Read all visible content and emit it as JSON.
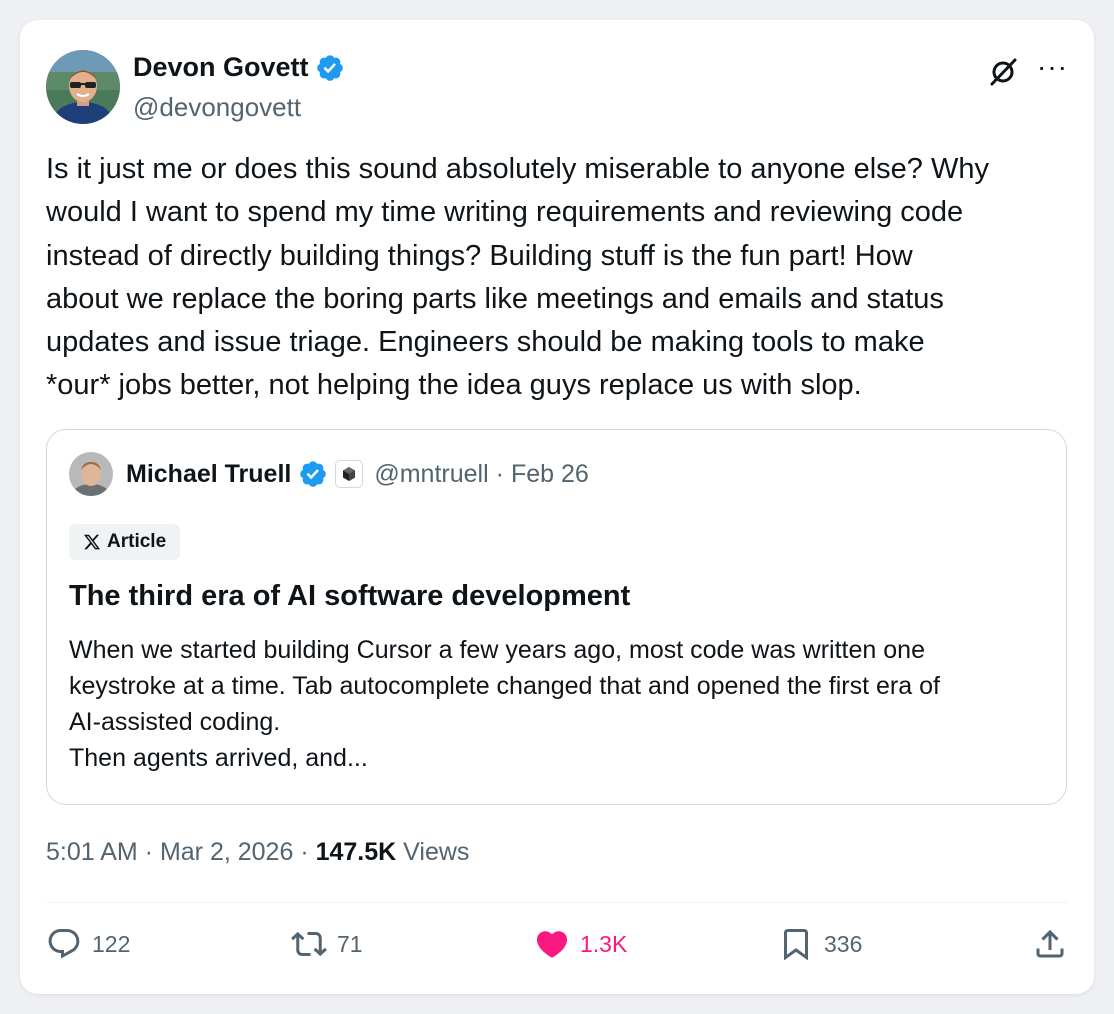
{
  "author": {
    "name": "Devon Govett",
    "handle": "@devongovett"
  },
  "tweet": {
    "lines": [
      "Is it just me or does this sound absolutely miserable to anyone else? Why",
      "would I want to spend my time writing requirements and reviewing code",
      "instead of directly building things? Building stuff is the fun part! How",
      "about we replace the boring parts like meetings and emails and status",
      "updates and issue triage. Engineers should be making tools to make",
      "*our* jobs better, not helping the idea guys replace us with slop."
    ]
  },
  "quote": {
    "name": "Michael Truell",
    "handle": "@mntruell",
    "separator": " · ",
    "date": "Feb 26",
    "chip_label": "Article",
    "title": "The third era of AI software development",
    "body_lines": [
      "When we started building Cursor a few years ago, most code was written one",
      "keystroke at a time. Tab autocomplete changed that and opened the first era of",
      "AI-assisted coding.",
      "Then agents arrived, and..."
    ]
  },
  "meta": {
    "time": "5:01 AM",
    "sep1": " · ",
    "date": "Mar 2, 2026",
    "sep2": " · ",
    "views_count": "147.5K",
    "views_label": " Views"
  },
  "actions": {
    "replies": "122",
    "reposts": "71",
    "likes": "1.3K",
    "bookmarks": "336"
  },
  "colors": {
    "verified_blue": "#1d9bf0",
    "like_pink": "#f91880",
    "secondary_text": "#536471",
    "border": "#cfd9de"
  },
  "icons": [
    "verified-badge-icon",
    "grok-icon",
    "more-icon",
    "x-logo-icon",
    "reply-icon",
    "repost-icon",
    "like-icon",
    "bookmark-icon",
    "share-icon"
  ]
}
